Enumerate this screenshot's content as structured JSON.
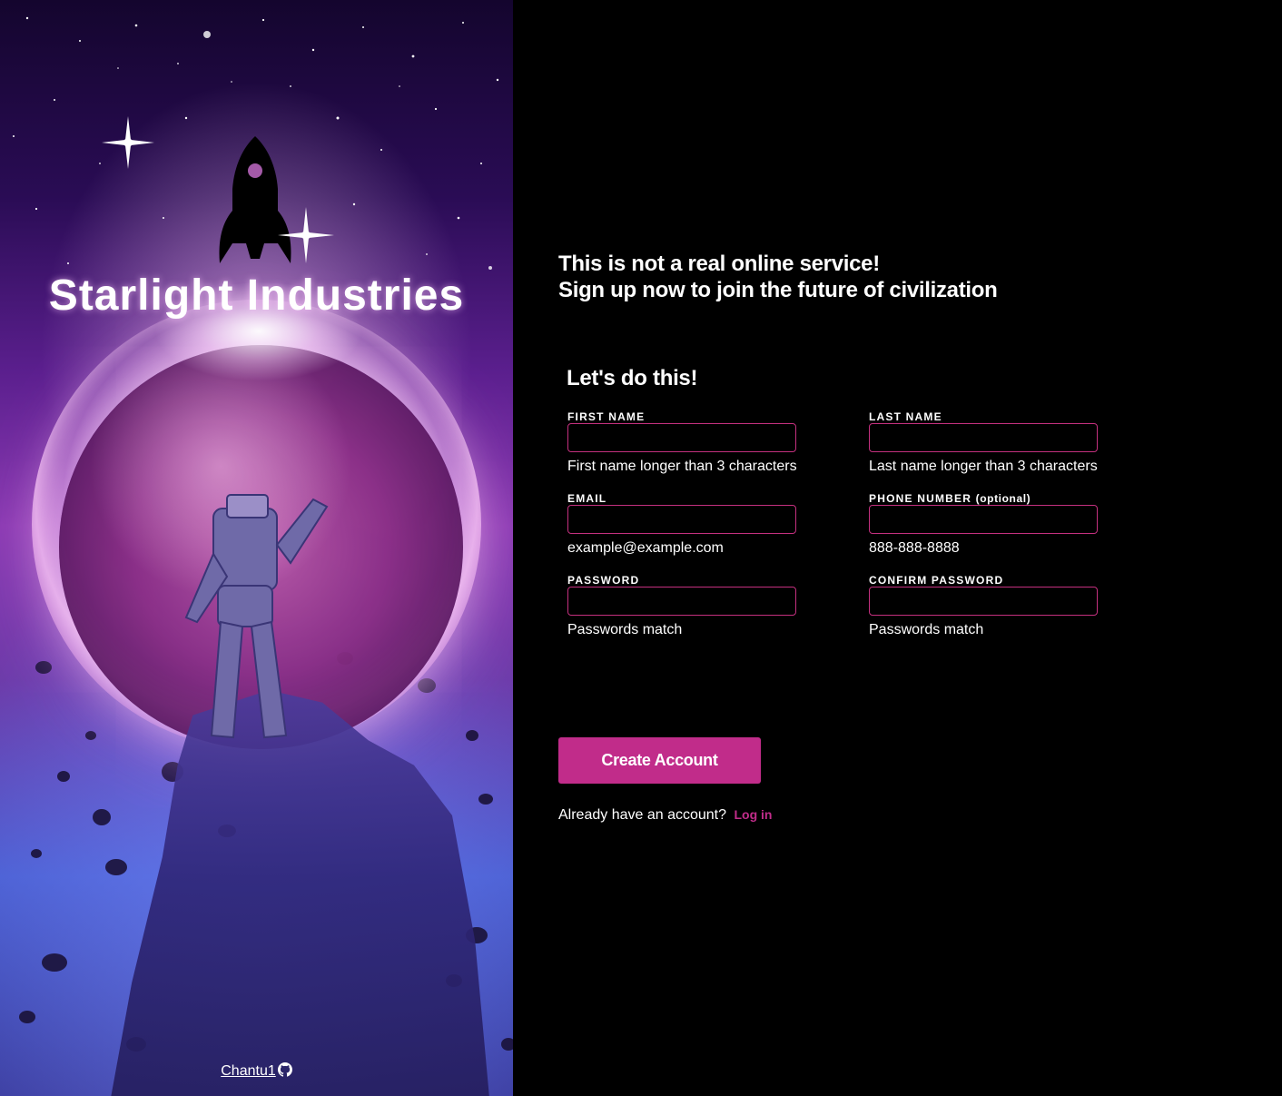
{
  "hero": {
    "brand": "Starlight Industries",
    "credit_link": "Chantu1",
    "rocket_icon": "rocket-icon",
    "github_icon": "github-icon"
  },
  "intro": {
    "line1": "This is not a real online service!",
    "line2": "Sign up now to join the future of civilization"
  },
  "form": {
    "title": "Let's do this!",
    "fields": {
      "first_name": {
        "label": "First Name",
        "value": "",
        "hint": "First name longer than 3 characters"
      },
      "last_name": {
        "label": "Last Name",
        "value": "",
        "hint": "Last name longer than 3 characters"
      },
      "email": {
        "label": "Email",
        "value": "",
        "hint": "example@example.com"
      },
      "phone": {
        "label": "Phone Number",
        "label_suffix": "(optional)",
        "value": "",
        "hint": "888-888-8888"
      },
      "password": {
        "label": "Password",
        "value": "",
        "hint": "Passwords match"
      },
      "confirm_password": {
        "label": "Confirm Password",
        "value": "",
        "hint": "Passwords match"
      }
    },
    "submit_label": "Create Account",
    "login_prompt": "Already have an account?",
    "login_link": "Log in"
  },
  "colors": {
    "accent": "#c12c8a",
    "input_border": "#c4307f",
    "background": "#000000"
  }
}
